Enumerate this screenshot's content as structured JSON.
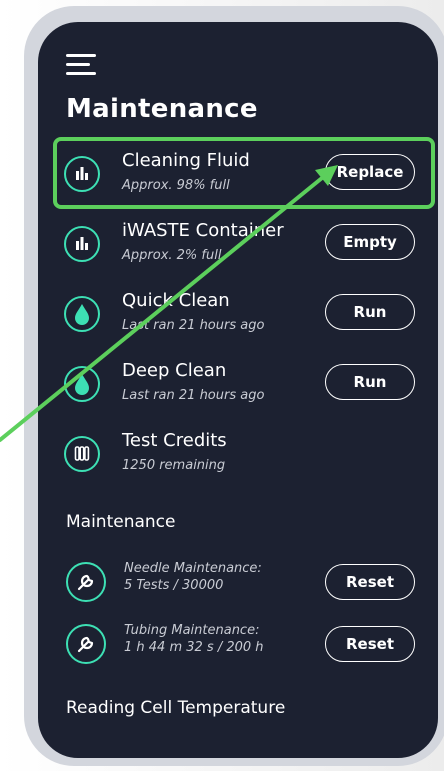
{
  "title": "Maintenance",
  "status_items": [
    {
      "title": "Cleaning Fluid",
      "subtitle": "Approx. 98% full",
      "action": "Replace",
      "icon": "bar-chart-icon"
    },
    {
      "title": "iWASTE Container",
      "subtitle": "Approx. 2% full",
      "action": "Empty",
      "icon": "bar-chart-icon"
    },
    {
      "title": "Quick Clean",
      "subtitle": "Last ran 21 hours ago",
      "action": "Run",
      "icon": "droplet-icon"
    },
    {
      "title": "Deep Clean",
      "subtitle": "Last ran 21 hours ago",
      "action": "Run",
      "icon": "droplet-icon"
    },
    {
      "title": "Test Credits",
      "subtitle": "1250 remaining",
      "icon": "test-tubes-icon"
    }
  ],
  "maintenance_section": {
    "heading": "Maintenance",
    "items": [
      {
        "label": "Needle Maintenance:",
        "value": "5 Tests / 30000",
        "action": "Reset",
        "icon": "wrench-icon"
      },
      {
        "label": "Tubing Maintenance:",
        "value": "1 h 44 m 32 s / 200 h",
        "action": "Reset",
        "icon": "wrench-icon"
      }
    ]
  },
  "temperature_section": {
    "heading": "Reading Cell Temperature"
  },
  "colors": {
    "background": "#1c2131",
    "accent": "#3de0b4",
    "highlight": "#5ccf5c",
    "frame": "#d3d6dd"
  }
}
